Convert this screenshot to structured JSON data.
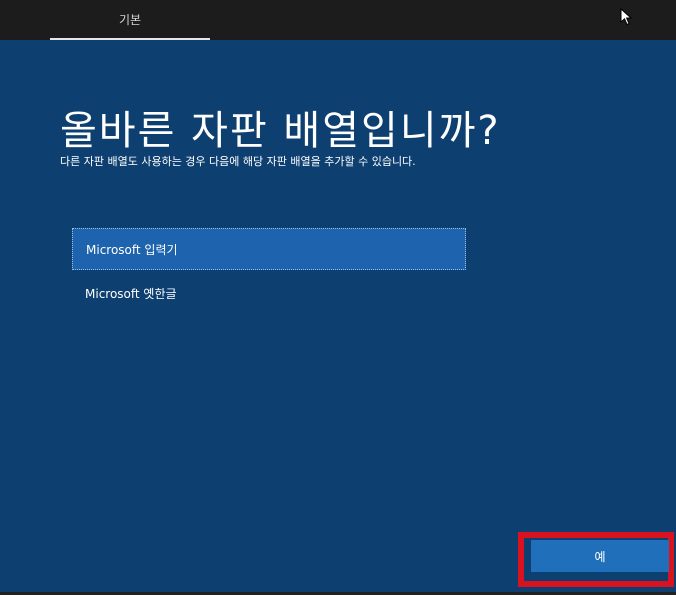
{
  "tabs": [
    {
      "label": "기본"
    }
  ],
  "page": {
    "title": "올바른 자판 배열입니까?",
    "subtitle": "다른 자판 배열도 사용하는 경우 다음에 해당 자판 배열을 추가할 수 있습니다."
  },
  "options": [
    {
      "label": "Microsoft 입력기",
      "selected": true
    },
    {
      "label": "Microsoft 옛한글",
      "selected": false
    }
  ],
  "actions": {
    "yes_label": "예"
  },
  "colors": {
    "background": "#0d3f70",
    "topbar": "#1c1c1c",
    "selected_item": "#1d63ad",
    "button": "#1f6fba",
    "highlight": "#d8121f"
  },
  "icons": [
    "mouse-cursor-icon"
  ]
}
